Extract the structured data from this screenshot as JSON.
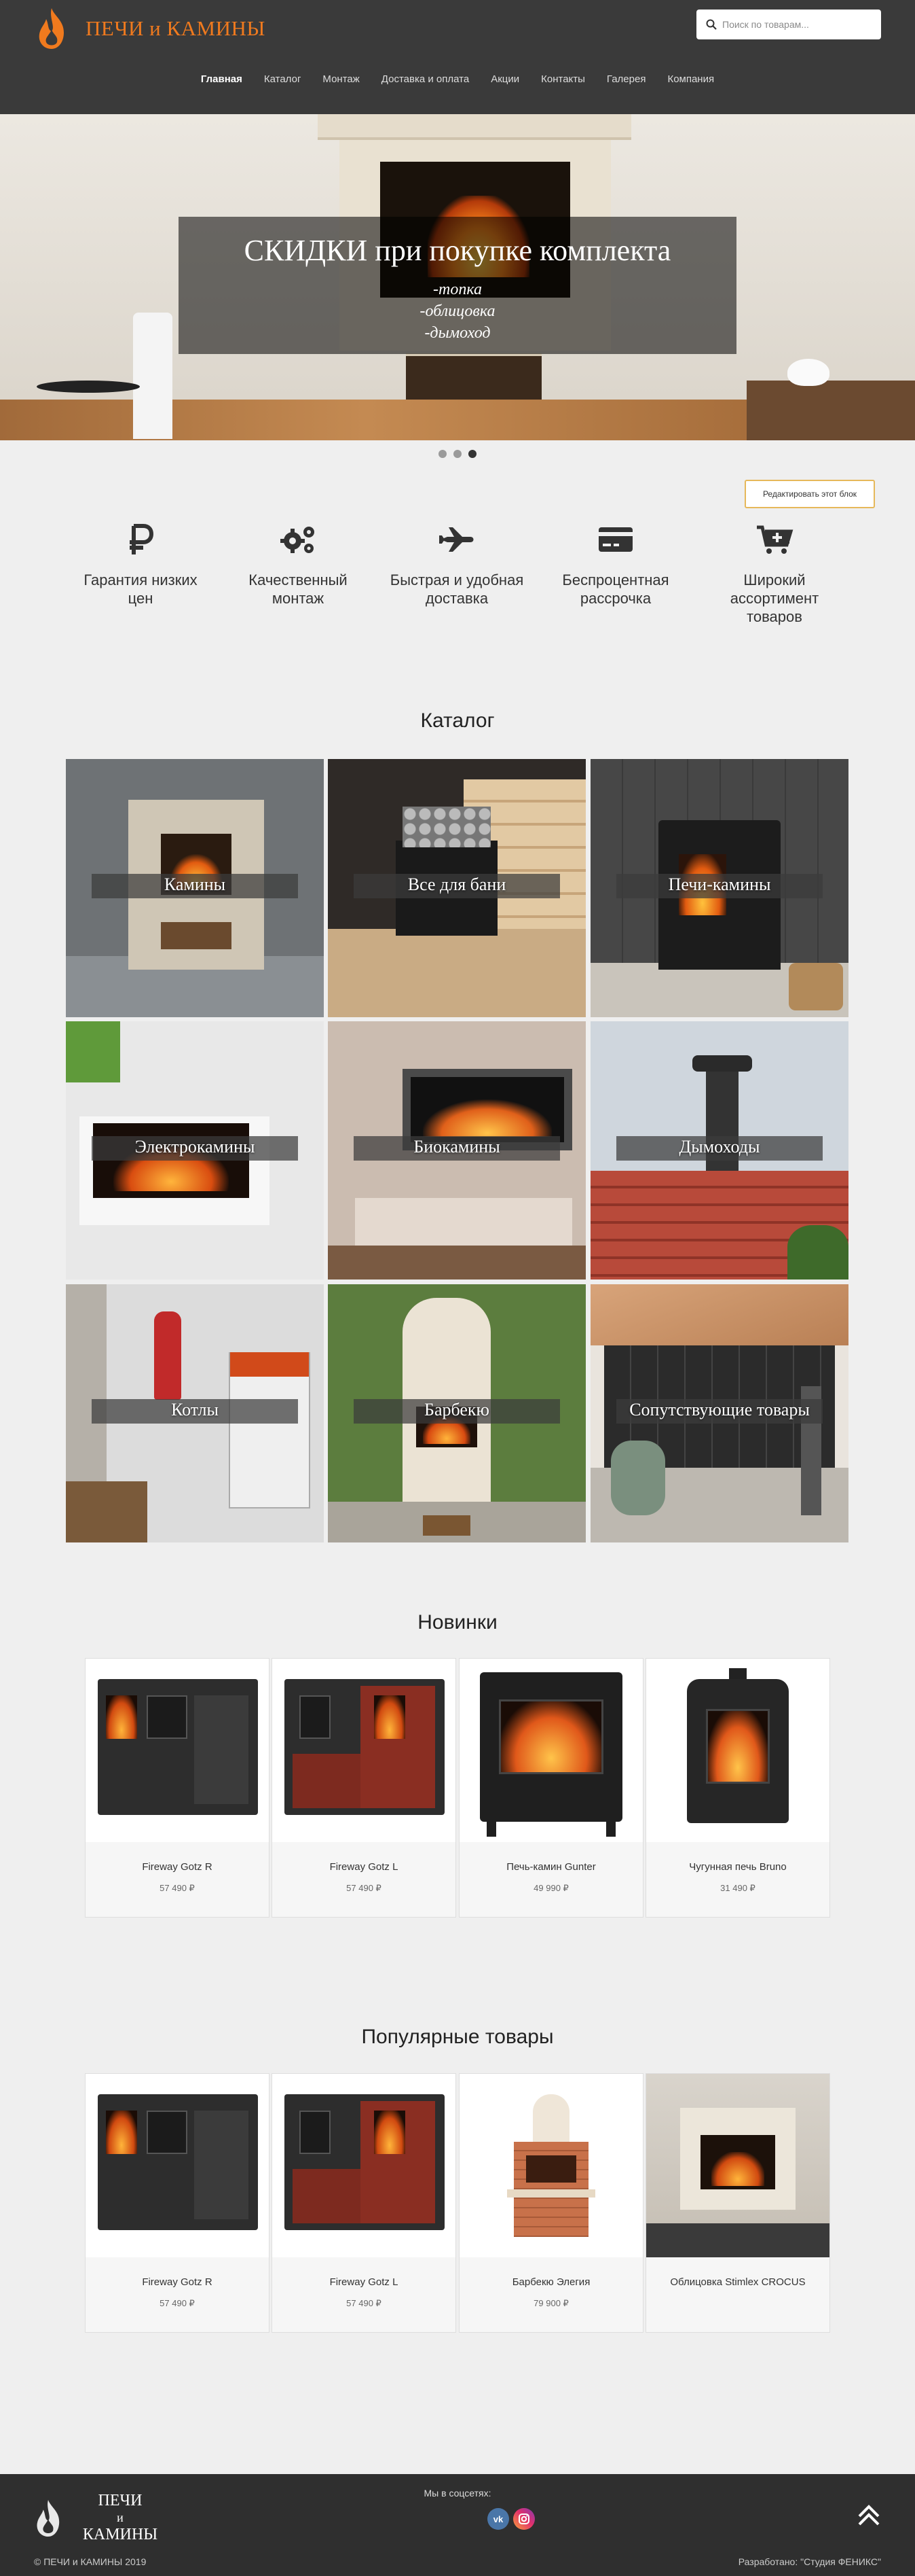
{
  "header": {
    "brand": "ПЕЧИ и КАМИНЫ",
    "search_placeholder": "Поиск по товарам...",
    "nav": [
      "Главная",
      "Каталог",
      "Монтаж",
      "Доставка и оплата",
      "Акции",
      "Контакты",
      "Галерея",
      "Компания"
    ],
    "active_nav": "Главная"
  },
  "hero": {
    "title": "СКИДКИ при покупке комплекта",
    "lines": [
      "-топка",
      "-облицовка",
      "-дымоход"
    ],
    "slide_count": 3,
    "active_slide": 3
  },
  "edit_block_label": "Редактировать этот блок",
  "features": [
    {
      "icon": "ruble-icon",
      "label": "Гарантия низких цен"
    },
    {
      "icon": "gears-icon",
      "label": "Качественный монтаж"
    },
    {
      "icon": "plane-icon",
      "label": "Быстрая и удобная доставка"
    },
    {
      "icon": "credit-card-icon",
      "label": "Беспроцентная рассрочка"
    },
    {
      "icon": "cart-plus-icon",
      "label": "Широкий ассортимент товаров"
    }
  ],
  "catalog": {
    "title": "Каталог",
    "items": [
      "Камины",
      "Все для бани",
      "Печи-камины",
      "Электрокамины",
      "Биокамины",
      "Дымоходы",
      "Котлы",
      "Барбекю",
      "Сопутствующие товары"
    ]
  },
  "new_products": {
    "title": "Новинки",
    "items": [
      {
        "name": "Fireway Gotz R",
        "price": "57 490 ₽"
      },
      {
        "name": "Fireway Gotz L",
        "price": "57 490 ₽"
      },
      {
        "name": "Печь-камин Gunter",
        "price": "49 990 ₽"
      },
      {
        "name": "Чугунная печь Bruno",
        "price": "31 490 ₽"
      }
    ]
  },
  "popular_products": {
    "title": "Популярные товары",
    "items": [
      {
        "name": "Fireway Gotz R",
        "price": "57 490 ₽"
      },
      {
        "name": "Fireway Gotz L",
        "price": "57 490 ₽"
      },
      {
        "name": "Барбекю Элегия",
        "price": "79 900 ₽"
      },
      {
        "name": "Облицовка Stimlex CROCUS",
        "price": ""
      }
    ]
  },
  "footer": {
    "brand_lines": [
      "ПЕЧИ",
      "и",
      "КАМИНЫ"
    ],
    "social_label": "Мы в соцсетях:",
    "social": [
      {
        "icon": "vk-icon",
        "label": "vk",
        "color": "#4a76a8"
      },
      {
        "icon": "instagram-icon",
        "label": "",
        "color": "#c13584"
      }
    ],
    "copyright": "© ПЕЧИ и КАМИНЫ 2019",
    "developer": "Разработано: \"Студия ФЕНИКС\""
  },
  "colors": {
    "header_bg": "#3a3a3a",
    "brand_orange": "#f07a1e",
    "page_bg": "#efefef",
    "footer_bg": "#2f2f2f",
    "edit_button_border": "#e6b85a"
  }
}
